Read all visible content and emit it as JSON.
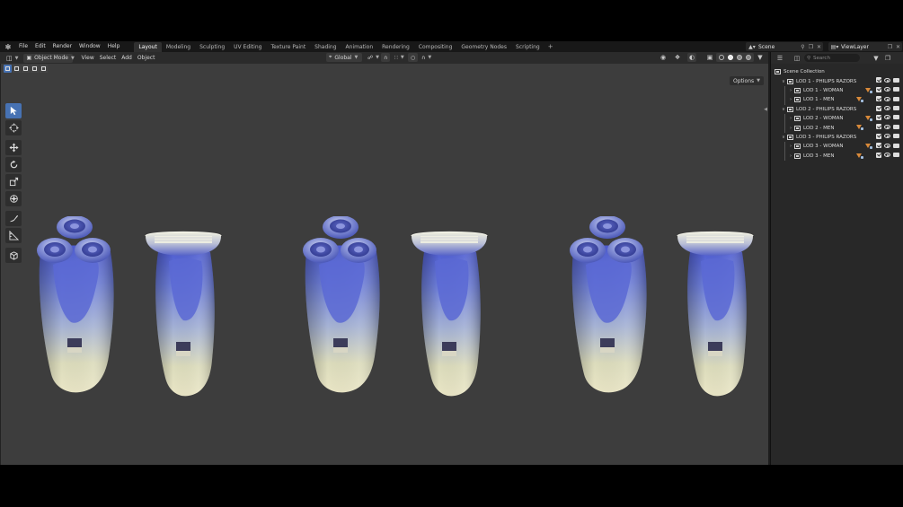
{
  "topbar": {
    "menus": [
      "File",
      "Edit",
      "Render",
      "Window",
      "Help"
    ],
    "workspaces": [
      "Layout",
      "Modeling",
      "Sculpting",
      "UV Editing",
      "Texture Paint",
      "Shading",
      "Animation",
      "Rendering",
      "Compositing",
      "Geometry Nodes",
      "Scripting"
    ],
    "active_workspace": "Layout",
    "add_tab": "+",
    "scene_name": "Scene",
    "view_layer_name": "ViewLayer"
  },
  "viewport_header": {
    "mode": "Object Mode",
    "menus": [
      "View",
      "Select",
      "Add",
      "Object"
    ],
    "orientation": "Global",
    "options_label": "Options"
  },
  "outliner": {
    "search_placeholder": "Search",
    "root": "Scene Collection",
    "rows": [
      {
        "label": "LOD 1 - PHILIPS RAZORS",
        "level": 1,
        "expanded": true,
        "filter": false
      },
      {
        "label": "LOD 1 - WOMAN",
        "level": 2,
        "expanded": false,
        "filter": true
      },
      {
        "label": "LOD 1 - MEN",
        "level": 2,
        "expanded": false,
        "filter": true
      },
      {
        "label": "LOD 2 - PHILIPS RAZORS",
        "level": 1,
        "expanded": true,
        "filter": false
      },
      {
        "label": "LOD 2 - WOMAN",
        "level": 2,
        "expanded": false,
        "filter": true
      },
      {
        "label": "LOD 2 - MEN",
        "level": 2,
        "expanded": false,
        "filter": true
      },
      {
        "label": "LOD 3 - PHILIPS RAZORS",
        "level": 1,
        "expanded": true,
        "filter": false
      },
      {
        "label": "LOD 3 - WOMAN",
        "level": 2,
        "expanded": false,
        "filter": true
      },
      {
        "label": "LOD 3 - MEN",
        "level": 2,
        "expanded": false,
        "filter": true
      }
    ]
  },
  "icons": {
    "tools": [
      "select-box-icon",
      "cursor-icon",
      "move-icon",
      "rotate-icon",
      "scale-icon",
      "transform-icon",
      "annotate-icon",
      "measure-icon",
      "add-cube-icon"
    ]
  },
  "colors": {
    "viewport_bg": "#3d3d3d",
    "accent": "#4772b3",
    "shaver_blue": "#5b6bd6",
    "shaver_cream": "#e6e2c0"
  }
}
